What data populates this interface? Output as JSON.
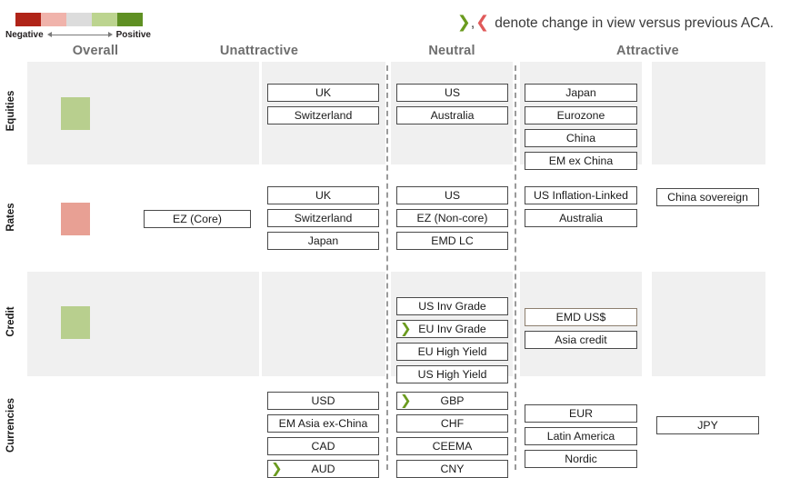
{
  "legend": {
    "scale_colors": [
      "#b02418",
      "#f0b3ab",
      "#dcdcdc",
      "#bcd48f",
      "#5f9023"
    ],
    "negative_label": "Negative",
    "positive_label": "Positive",
    "change_up_glyph": "❯",
    "change_sep": ",",
    "change_down_glyph": "❮",
    "change_note": "denote change in view versus previous ACA."
  },
  "columns": [
    {
      "key": "overall",
      "label": "Overall"
    },
    {
      "key": "unattractive",
      "label": "Unattractive"
    },
    {
      "key": "neutral",
      "label": "Neutral"
    },
    {
      "key": "attractive",
      "label": "Attractive"
    }
  ],
  "rows": [
    {
      "label": "Equities",
      "overall_color": "#b8cf8e",
      "overall_sentiment": "positive",
      "cells": {
        "unattractive_far": [],
        "unattractive_near": [
          {
            "text": "UK"
          },
          {
            "text": "Switzerland"
          }
        ],
        "neutral": [
          {
            "text": "US"
          },
          {
            "text": "Australia"
          }
        ],
        "attractive_near": [
          {
            "text": "Japan"
          },
          {
            "text": "Eurozone"
          },
          {
            "text": "China"
          },
          {
            "text": "EM ex China"
          }
        ],
        "attractive_far": []
      }
    },
    {
      "label": "Rates",
      "overall_color": "#e8a094",
      "overall_sentiment": "negative",
      "cells": {
        "unattractive_far": [
          {
            "text": "EZ (Core)"
          }
        ],
        "unattractive_near": [
          {
            "text": "UK"
          },
          {
            "text": "Switzerland"
          },
          {
            "text": "Japan"
          }
        ],
        "neutral": [
          {
            "text": "US"
          },
          {
            "text": "EZ (Non-core)"
          },
          {
            "text": "EMD LC"
          }
        ],
        "attractive_near": [
          {
            "text": "US Inflation-Linked"
          },
          {
            "text": "Australia"
          }
        ],
        "attractive_far": [
          {
            "text": "China sovereign"
          }
        ]
      }
    },
    {
      "label": "Credit",
      "overall_color": "#b8cf8e",
      "overall_sentiment": "positive",
      "cells": {
        "unattractive_far": [],
        "unattractive_near": [],
        "neutral": [
          {
            "text": "US Inv Grade"
          },
          {
            "text": "EU Inv Grade",
            "marker": "up"
          },
          {
            "text": "EU High Yield"
          },
          {
            "text": "US High Yield"
          }
        ],
        "attractive_near": [
          {
            "text": "EMD US$",
            "style": "tan"
          },
          {
            "text": "Asia credit"
          }
        ],
        "attractive_far": []
      }
    },
    {
      "label": "Currencies",
      "overall_color": null,
      "overall_sentiment": "none",
      "cells": {
        "unattractive_far": [],
        "unattractive_near": [
          {
            "text": "USD"
          },
          {
            "text": "EM Asia ex-China"
          },
          {
            "text": "CAD"
          },
          {
            "text": "AUD",
            "marker": "up"
          }
        ],
        "neutral": [
          {
            "text": "GBP",
            "marker": "up"
          },
          {
            "text": "CHF"
          },
          {
            "text": "CEEMA"
          },
          {
            "text": "CNY"
          }
        ],
        "attractive_near": [
          {
            "text": "EUR"
          },
          {
            "text": "Latin America"
          },
          {
            "text": "Nordic"
          }
        ],
        "attractive_far": [
          {
            "text": "JPY"
          }
        ]
      }
    }
  ]
}
